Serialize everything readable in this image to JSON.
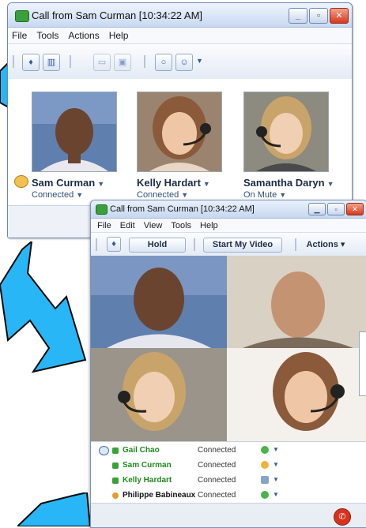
{
  "back_window": {
    "title": "Call from Sam Curman [10:34:22 AM]",
    "window_buttons": {
      "minimize": "_",
      "maximize": "▫",
      "close": "✕"
    },
    "menu": [
      "File",
      "Tools",
      "Actions",
      "Help"
    ],
    "participants": [
      {
        "name": "Sam Curman",
        "status": "Connected"
      },
      {
        "name": "Kelly Hardart",
        "status": "Connected"
      },
      {
        "name": "Samantha Daryn",
        "status": "On Mute"
      }
    ]
  },
  "front_window": {
    "title": "Call from Sam Curman [10:34:22 AM]",
    "menu": [
      "File",
      "Edit",
      "View",
      "Tools",
      "Help"
    ],
    "toolbar": {
      "hold": "Hold",
      "video": "Start My Video",
      "actions": "Actions ▾"
    },
    "participants": [
      {
        "name": "Gail Chao",
        "status": "Connected",
        "color": "#1f8a1f"
      },
      {
        "name": "Sam Curman",
        "status": "Connected",
        "color": "#1f8a1f"
      },
      {
        "name": "Kelly Hardart",
        "status": "Connected",
        "color": "#1f8a1f"
      },
      {
        "name": "Philippe Babineaux",
        "status": "Connected",
        "color": "#111111"
      }
    ]
  },
  "colors": {
    "arrow": "#29b6f6",
    "arrow_outline": "#0a0a0a",
    "title_bar": "#c9d9f1",
    "accent": "#2d5aa8"
  },
  "icons": [
    "phone-icon",
    "microphone-icon",
    "keypad-icon",
    "video-icon",
    "chat-icon",
    "emoticon-icon",
    "hangup-icon"
  ]
}
